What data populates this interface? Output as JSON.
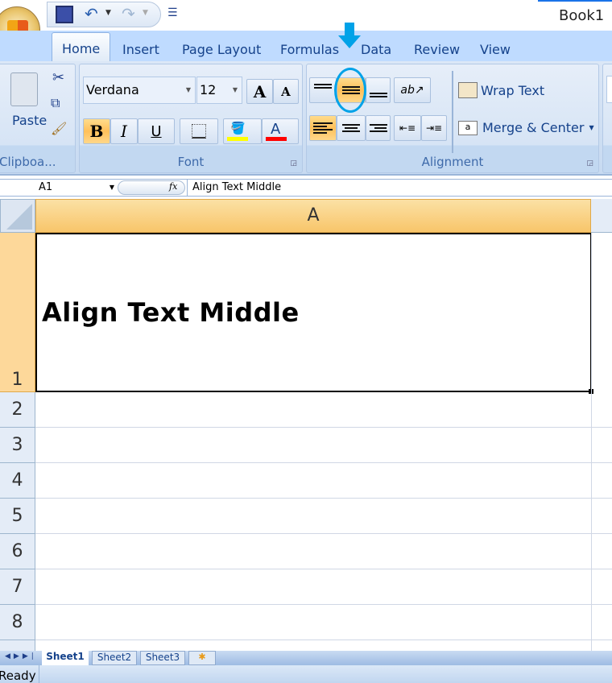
{
  "window": {
    "title": "Book1 -"
  },
  "quick_access": {
    "icons": [
      "save-icon",
      "undo-icon",
      "redo-icon",
      "customize-icon"
    ]
  },
  "tabs": [
    {
      "label": "Home",
      "active": true
    },
    {
      "label": "Insert"
    },
    {
      "label": "Page Layout"
    },
    {
      "label": "Formulas"
    },
    {
      "label": "Data"
    },
    {
      "label": "Review"
    },
    {
      "label": "View"
    }
  ],
  "clipboard": {
    "label": "Clipboa...",
    "paste": "Paste"
  },
  "font": {
    "label": "Font",
    "name": "Verdana",
    "size": "12",
    "bold": "B",
    "italic": "I",
    "underline": "U",
    "font_color_glyph": "A",
    "fill_color": "#ffff00",
    "font_color": "#ff0000"
  },
  "alignment": {
    "label": "Alignment",
    "wrap_text": "Wrap Text",
    "merge_center": "Merge & Center",
    "merge_icon_text": "a",
    "active_vertical": "middle",
    "active_horizontal": "left",
    "highlight_color": "#00a2e8"
  },
  "formula_bar": {
    "name_box": "A1",
    "fx": "fx",
    "content": "Align Text Middle"
  },
  "sheet": {
    "column": "A",
    "rows": [
      "1",
      "2",
      "3",
      "4",
      "5",
      "6",
      "7",
      "8"
    ],
    "cell_a1": "Align Text Middle"
  },
  "sheet_tabs": [
    "Sheet1",
    "Sheet2",
    "Sheet3"
  ],
  "status": {
    "text": "Ready"
  }
}
